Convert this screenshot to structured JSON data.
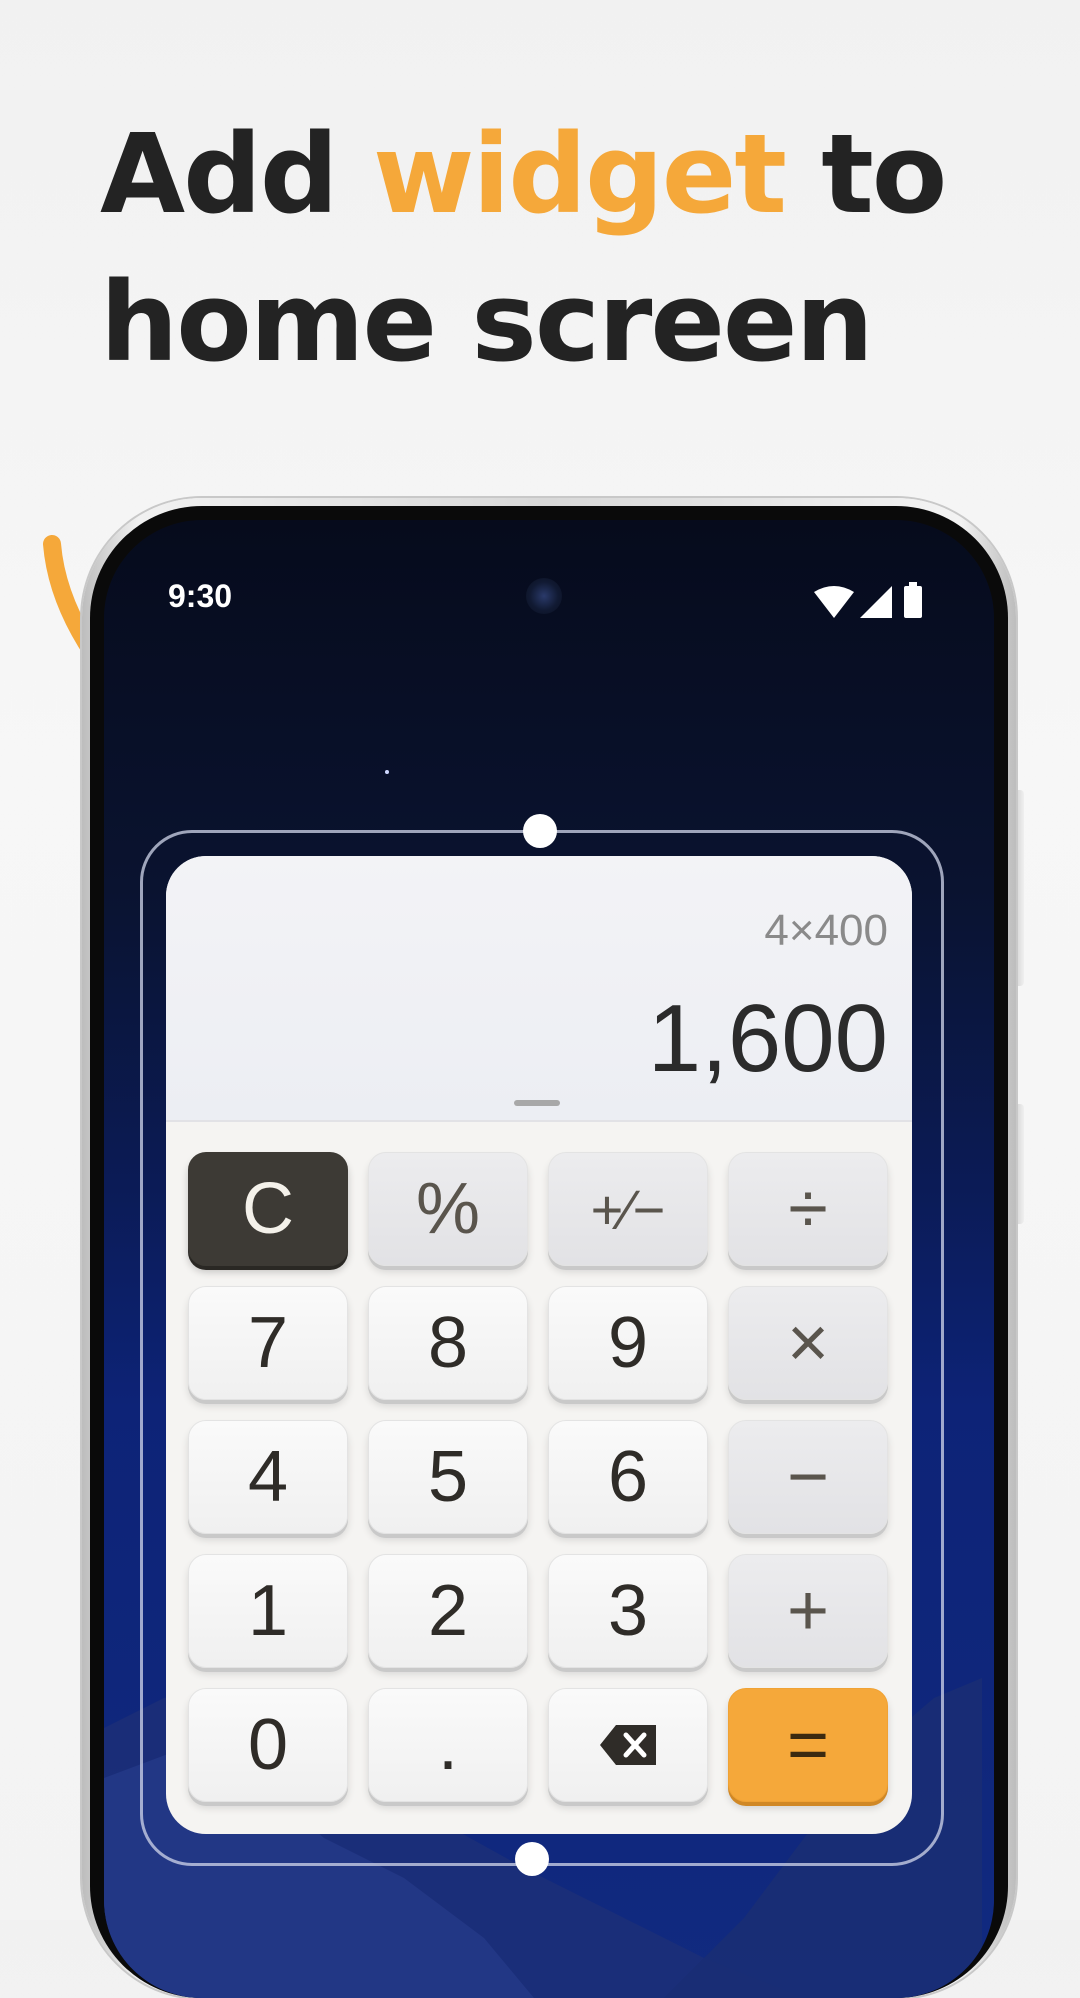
{
  "headline": {
    "part1": "Add ",
    "accent": "widget",
    "part2": " to home screen"
  },
  "status_bar": {
    "time": "9:30",
    "icons": [
      "wifi-icon",
      "signal-icon",
      "battery-icon"
    ]
  },
  "calculator": {
    "expression": "4×400",
    "result": "1,600",
    "keys": [
      [
        "C",
        "%",
        "+⁄−",
        "÷"
      ],
      [
        "7",
        "8",
        "9",
        "×"
      ],
      [
        "4",
        "5",
        "6",
        "−"
      ],
      [
        "1",
        "2",
        "3",
        "+"
      ],
      [
        "0",
        ".",
        "backspace",
        "="
      ]
    ]
  },
  "colors": {
    "accent": "#f5a83a",
    "clear_key": "#3d3a35",
    "headline_text": "#232323"
  }
}
